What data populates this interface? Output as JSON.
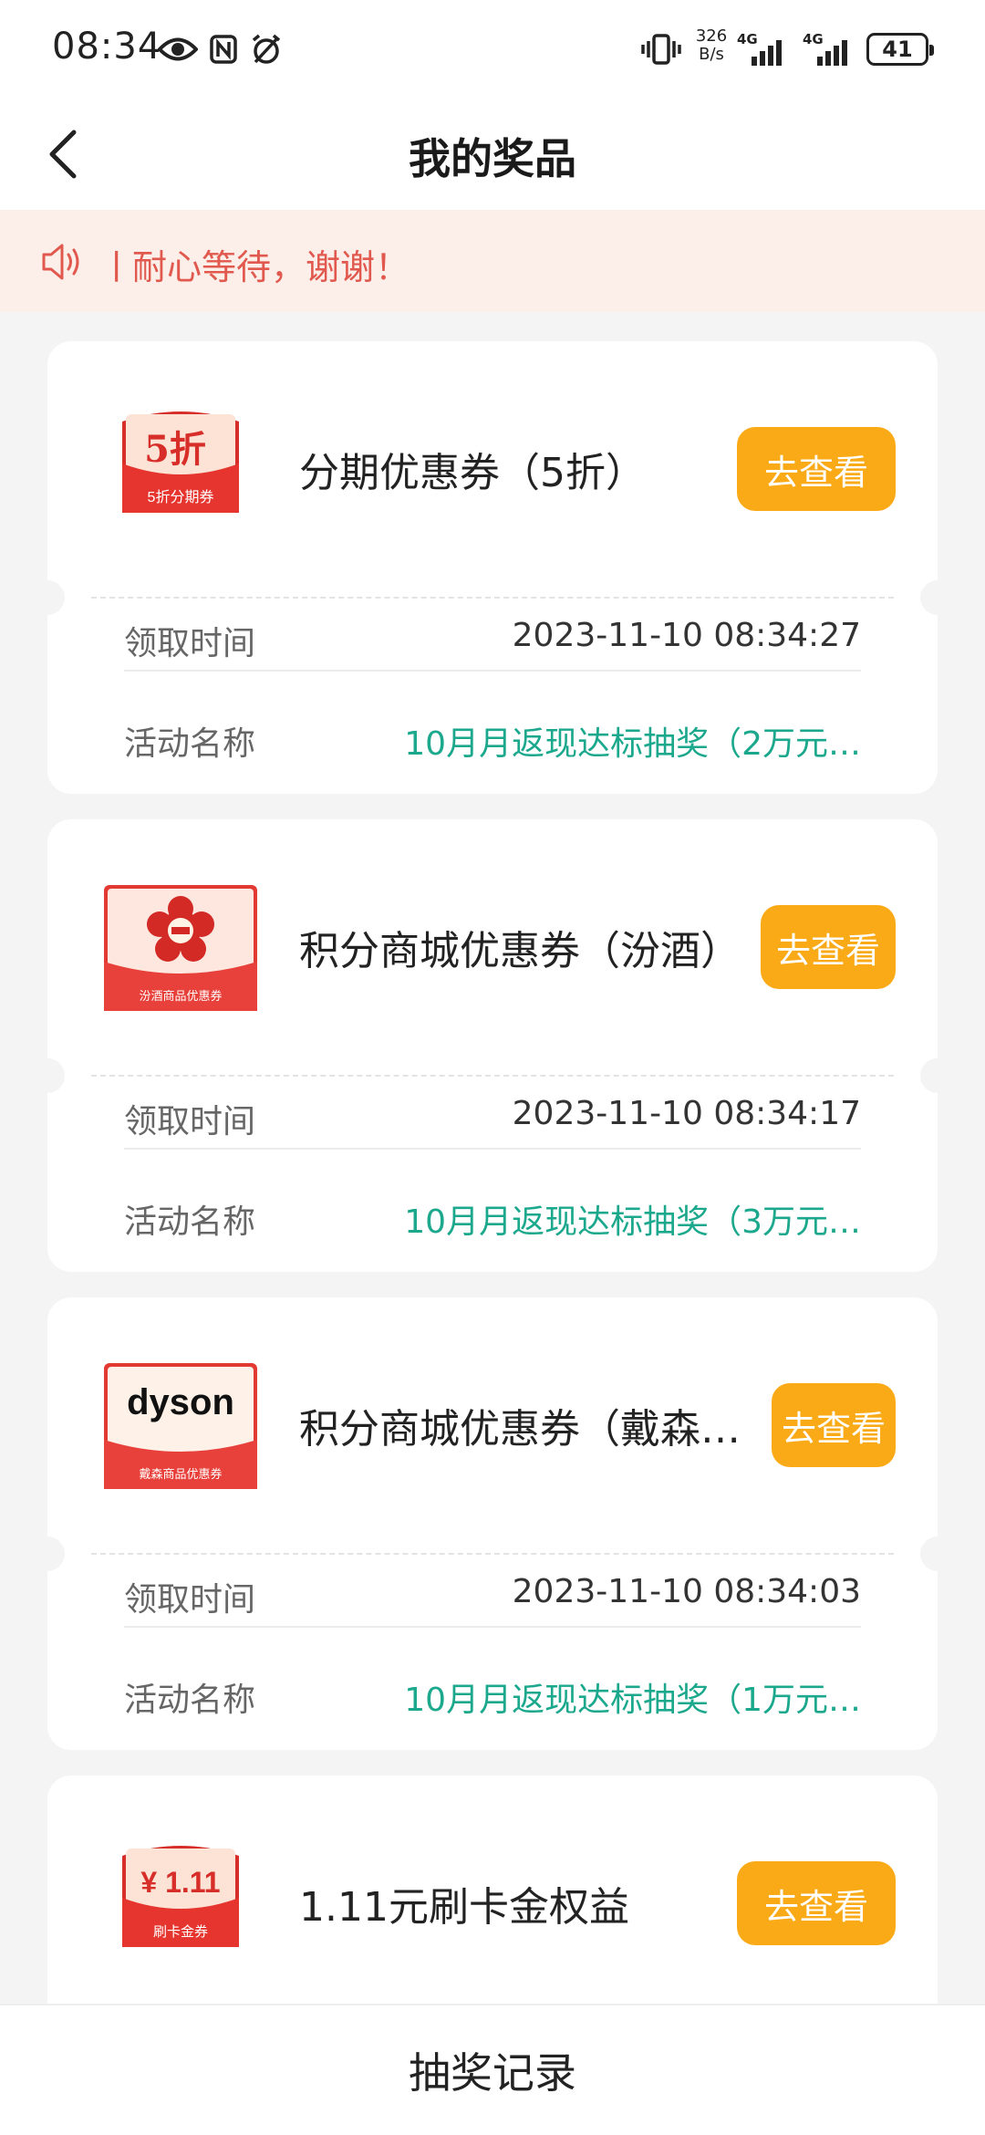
{
  "status_bar": {
    "time": "08:34",
    "net_speed": "326\nB/s",
    "signal_label_1": "4G",
    "signal_label_2": "4G",
    "battery": "41"
  },
  "header": {
    "title": "我的奖品",
    "back_icon": "chevron-left-icon"
  },
  "notice": {
    "icon": "speaker-icon",
    "text": "ㅣ耐心等待，谢谢！"
  },
  "labels": {
    "receive_time": "领取时间",
    "activity_name": "活动名称",
    "view_button": "去查看"
  },
  "prizes": [
    {
      "name": "分期优惠券（5折）",
      "thumb_big_text": "5折",
      "thumb_small_text": "5折分期券",
      "receive_time": "2023-11-10 08:34:27",
      "activity": "10月月返现达标抽奖（2万元…"
    },
    {
      "name": "积分商城优惠券（汾酒）",
      "thumb_small_text": "汾酒商品优惠券",
      "receive_time": "2023-11-10 08:34:17",
      "activity": "10月月返现达标抽奖（3万元…"
    },
    {
      "name": "积分商城优惠券（戴森…",
      "thumb_big_text": "dyson",
      "thumb_small_text": "戴森商品优惠券",
      "receive_time": "2023-11-10 08:34:03",
      "activity": "10月月返现达标抽奖（1万元…"
    },
    {
      "name": "1.11元刷卡金权益",
      "thumb_big_text": "¥ 1.11",
      "thumb_small_text": "刷卡金券"
    }
  ],
  "bottom": {
    "record_label": "抽奖记录"
  },
  "colors": {
    "accent_button": "#fbaa17",
    "activity_text": "#1ba88c",
    "notice_bg": "#fceee8",
    "notice_text": "#e0584e"
  }
}
